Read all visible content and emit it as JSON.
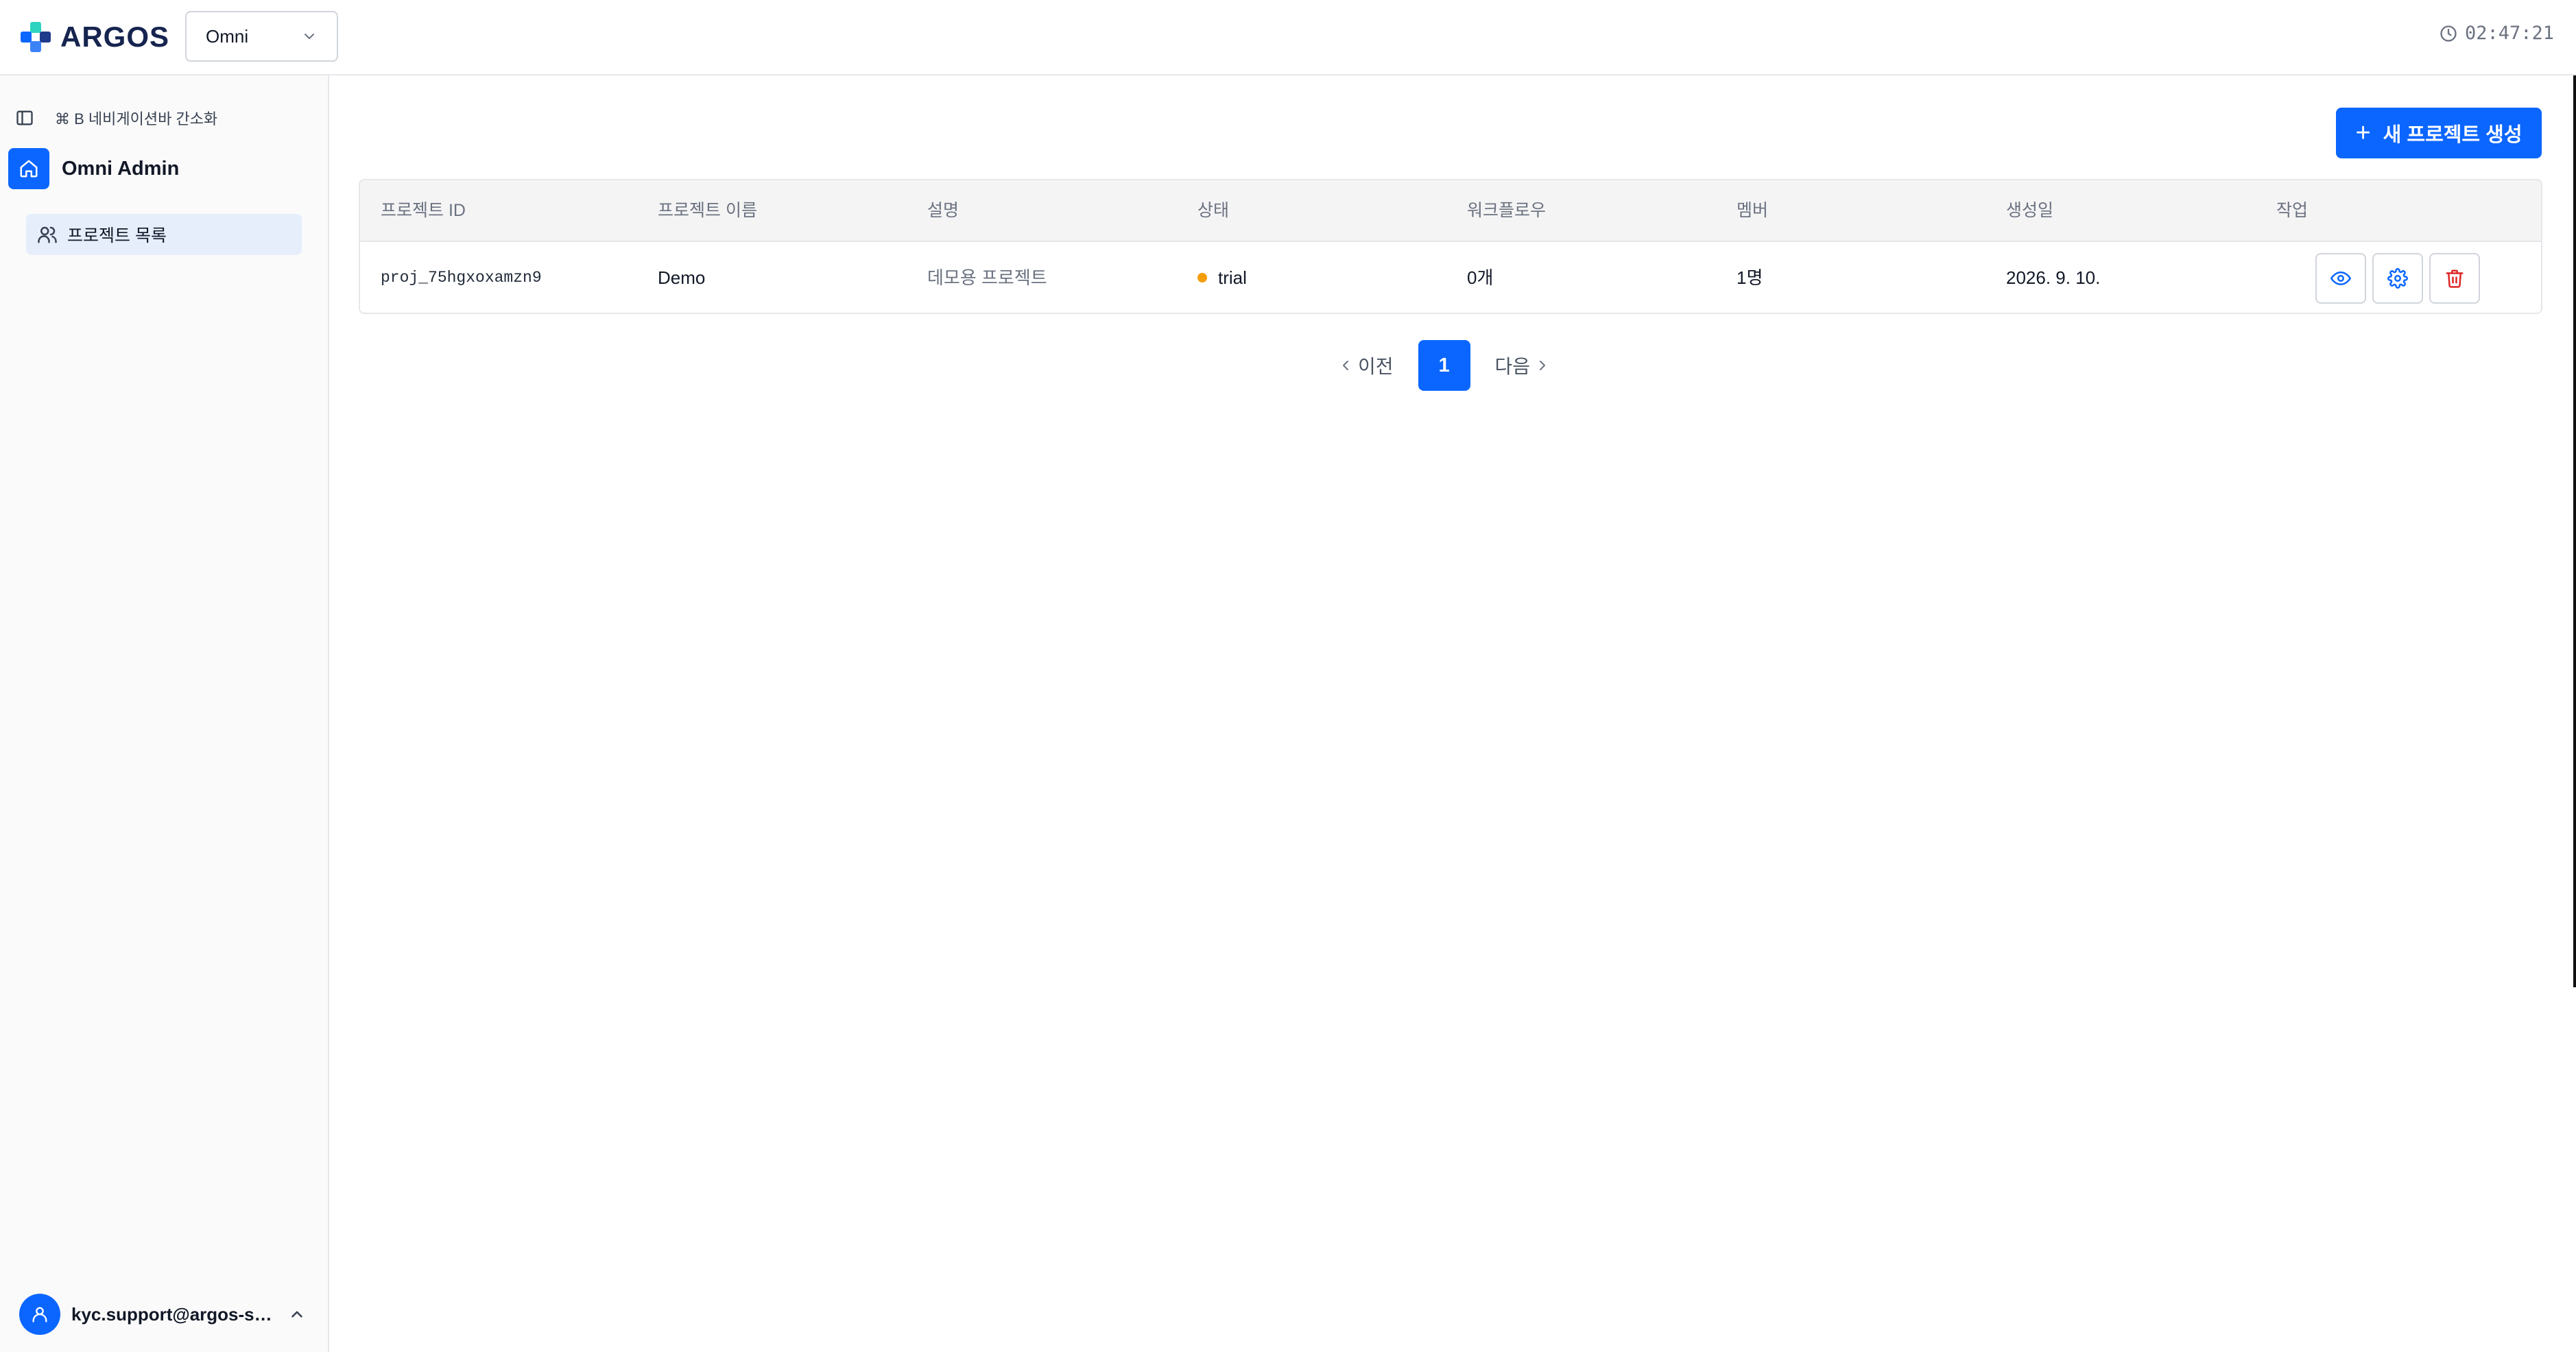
{
  "header": {
    "logo_text": "ARGOS",
    "project_selector": {
      "value": "Omni"
    },
    "clock": "02:47:21"
  },
  "sidebar": {
    "collapse_hint": "⌘ B 네비게이션바 간소화",
    "admin_title": "Omni Admin",
    "nav_items": [
      {
        "label": "프로젝트 목록",
        "icon": "users-icon",
        "active": true
      }
    ],
    "user_email": "kyc.support@argos-solutions.io"
  },
  "main": {
    "new_project_button": {
      "icon": "+",
      "label": "새 프로젝트 생성"
    },
    "table": {
      "columns": [
        "프로젝트 ID",
        "프로젝트 이름",
        "설명",
        "상태",
        "워크플로우",
        "멤버",
        "생성일",
        "작업"
      ],
      "rows": [
        {
          "id": "proj_75hgxoxamzn9",
          "name": "Demo",
          "description": "데모용 프로젝트",
          "status": "trial",
          "workflows": "0개",
          "members": "1명",
          "created": "2026. 9. 10.",
          "actions": [
            "eye-icon",
            "gear-icon",
            "trash-icon"
          ]
        }
      ]
    },
    "pagination": {
      "prev": "이전",
      "current": "1",
      "next": "다음"
    }
  },
  "colors": {
    "accent": "#0a66ff",
    "status_trial": "#f59e0b",
    "danger": "#dc2626",
    "logo_text": "#16244f"
  }
}
